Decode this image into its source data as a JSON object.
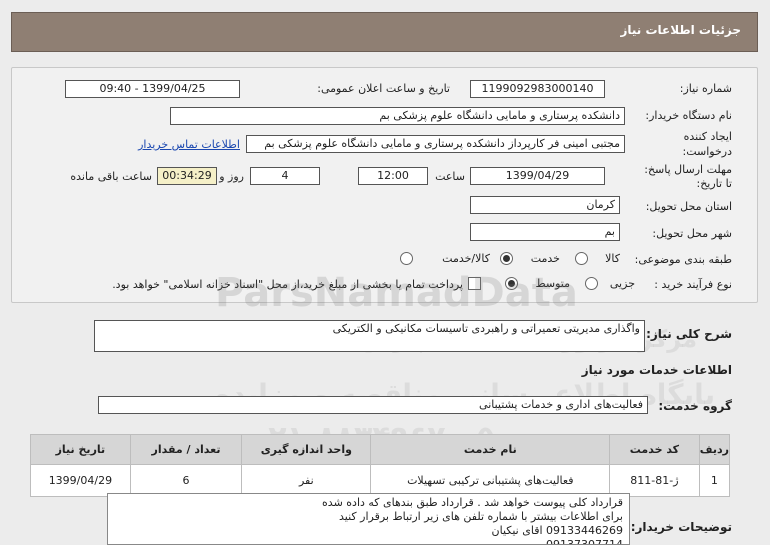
{
  "header": {
    "title": "جزئیات اطلاعات نیاز"
  },
  "form": {
    "need_number_label": "شماره نیاز:",
    "need_number": "1199092983000140",
    "announce_label": "تاریخ و ساعت اعلان عمومی:",
    "announce_value": "1399/04/25 - 09:40",
    "buyer_label": "نام دستگاه خریدار:",
    "buyer_value": "دانشکده پرستاری و مامایی دانشگاه علوم پزشکی بم",
    "creator_label_1": "ایجاد کننده",
    "creator_label_2": "درخواست:",
    "creator_value": "مجتبی امینی فر کارپرداز دانشکده پرستاری و مامایی دانشگاه علوم پزشکی بم",
    "contact_link": "اطلاعات تماس خریدار",
    "deadline_label_1": "مهلت ارسال پاسخ:",
    "deadline_label_2": "تا تاریخ:",
    "deadline_date": "1399/04/29",
    "time_label": "ساعت",
    "deadline_time": "12:00",
    "days_value": "4",
    "days_label": "روز و",
    "remaining_value": "00:34:29",
    "remaining_label": "ساعت باقی مانده",
    "province_label": "استان محل تحویل:",
    "province_value": "کرمان",
    "city_label": "شهر محل تحویل:",
    "city_value": "بم",
    "category_label": "طبقه بندی موضوعی:",
    "category_options": [
      "کالا",
      "خدمت",
      "کالا/خدمت"
    ],
    "category_selected": "خدمت",
    "process_label": "نوع فرآیند خرید :",
    "process_options": [
      "جزیی",
      "متوسط"
    ],
    "process_selected": "متوسط",
    "payment_text": "پرداخت تمام یا بخشی از مبلغ خرید،از محل \"اسناد خزانه اسلامی\" خواهد بود."
  },
  "summary": {
    "label": "شرح کلی نیاز:",
    "value": "واگذاری مدیریتی تعمیراتی و راهبردی تاسیسات مکانیکی و الکتریکی"
  },
  "services_section": {
    "title": "اطلاعات خدمات مورد نیاز",
    "group_label": "گروه خدمت:",
    "group_value": "فعالیت‌های اداری و خدمات پشتیبانی"
  },
  "table": {
    "headers": [
      "ردیف",
      "کد خدمت",
      "نام خدمت",
      "واحد اندازه گیری",
      "تعداد / مقدار",
      "تاریخ نیاز"
    ],
    "rows": [
      [
        "1",
        "ژ-81-811",
        "فعالیت‌های پشتیبانی ترکیبی تسهیلات",
        "نفر",
        "6",
        "1399/04/29"
      ]
    ]
  },
  "notes": {
    "label": "توضیحات خریدار:",
    "lines": [
      "قرارداد کلی پیوست خواهد شد . قرارداد طبق بندهای که داده شده",
      "برای اطلاعات بیشتر با شماره تلفن های زیر ارتباط برقرار کنید",
      "09133446269 اقای نیکیان",
      "09137307714"
    ]
  },
  "watermark": {
    "brand": "ParsNamadData",
    "line1": "مرکز فراوری اطلاعات پارس نماد داده",
    "line2": "پایگاه اطلاع رسانی مناقصه و مزایده",
    "phone": "۰۲۱-۸۸۳۴۹۶۷۰-۵"
  }
}
